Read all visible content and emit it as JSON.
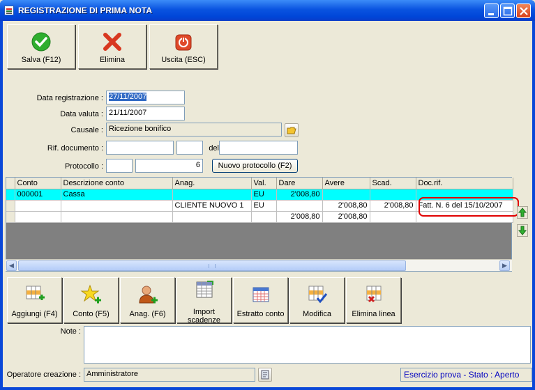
{
  "window": {
    "title": "REGISTRAZIONE DI PRIMA NOTA"
  },
  "toolbar": {
    "save_label": "Salva (F12)",
    "delete_label": "Elimina",
    "exit_label": "Uscita (ESC)"
  },
  "form": {
    "data_registrazione_label": "Data registrazione :",
    "data_registrazione_value": "27/11/2007",
    "data_valuta_label": "Data valuta :",
    "data_valuta_value": "21/11/2007",
    "causale_label": "Causale :",
    "causale_value": "Ricezione bonifico",
    "rif_documento_label": "Rif. documento :",
    "rif_doc_value": "",
    "rif_doc_suffix": "",
    "del_label": "del",
    "rif_doc_date": "",
    "protocollo_label": "Protocollo :",
    "protocollo_prefix": "",
    "protocollo_value": "6",
    "nuovo_protocollo_label": "Nuovo protocollo (F2)"
  },
  "grid": {
    "columns": [
      "Conto",
      "Descrizione conto",
      "Anag.",
      "Val.",
      "Dare",
      "Avere",
      "Scad.",
      "Doc.rif."
    ],
    "rows": [
      [
        "000001",
        "Cassa",
        "",
        "EU",
        "2'008,80",
        "",
        "",
        ""
      ],
      [
        "",
        "",
        "CLIENTE NUOVO 1",
        "EU",
        "",
        "2'008,80",
        "2'008,80",
        "Fatt. N. 6 del 15/10/2007"
      ],
      [
        "",
        "",
        "",
        "",
        "2'008,80",
        "2'008,80",
        "",
        ""
      ]
    ]
  },
  "actions": {
    "aggiungi": "Aggiungi (F4)",
    "conto": "Conto (F5)",
    "anag": "Anag. (F6)",
    "import_line1": "Import",
    "import_line2": "scadenze",
    "estratto": "Estratto conto",
    "modifica": "Modifica",
    "elimina_linea": "Elimina linea"
  },
  "notes": {
    "label": "Note :",
    "value": ""
  },
  "footer": {
    "operatore_label": "Operatore creazione :",
    "operatore_value": "Amministratore",
    "status_text": "Esercizio prova - Stato : Aperto"
  },
  "colors": {
    "titlebar": "#0a54e0",
    "highlight_row": "#00ffff",
    "annotation": "#e00000",
    "status_text": "#0000c0"
  }
}
